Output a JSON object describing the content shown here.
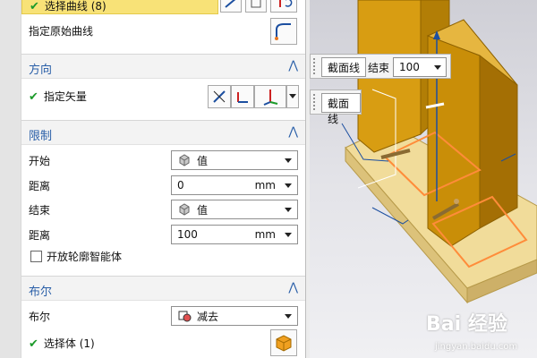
{
  "panel": {
    "selected_curve_label": "选择曲线 (8)",
    "original_curve_label": "指定原始曲线",
    "direction": {
      "title": "方向",
      "vector_label": "指定矢量"
    },
    "limits": {
      "title": "限制",
      "start_label": "开始",
      "start_value": "值",
      "distance1_label": "距离",
      "distance1_value": "0",
      "distance1_unit": "mm",
      "end_label": "结束",
      "end_value": "值",
      "distance2_label": "距离",
      "distance2_value": "100",
      "distance2_unit": "mm",
      "open_profile_label": "开放轮廓智能体"
    },
    "boolean": {
      "title": "布尔",
      "bool_label": "布尔",
      "bool_value": "减去",
      "select_body_label": "选择体 (1)"
    }
  },
  "viewport": {
    "section_line_label": "截面线",
    "end_label": "结束",
    "end_value": "100",
    "section_line_label2": "截面线",
    "watermark": "Bai 经验",
    "watermark_url": "jingyan.baidu.com"
  },
  "colors": {
    "accent": "#2a5fa8",
    "check": "#1c9a2a",
    "highlight": "#f8e277",
    "solid": "#e0a010",
    "base": "#efd78f"
  }
}
